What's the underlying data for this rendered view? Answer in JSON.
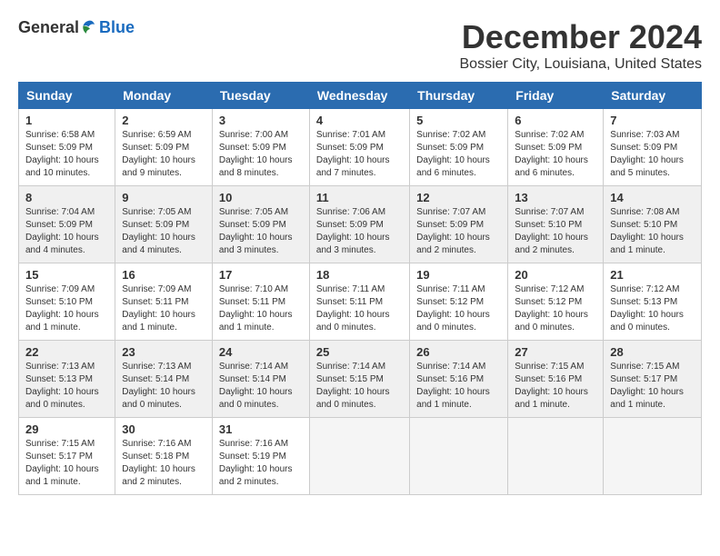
{
  "logo": {
    "general": "General",
    "blue": "Blue"
  },
  "title": {
    "month": "December 2024",
    "location": "Bossier City, Louisiana, United States"
  },
  "headers": [
    "Sunday",
    "Monday",
    "Tuesday",
    "Wednesday",
    "Thursday",
    "Friday",
    "Saturday"
  ],
  "weeks": [
    [
      {
        "day": "1",
        "sunrise": "Sunrise: 6:58 AM",
        "sunset": "Sunset: 5:09 PM",
        "daylight": "Daylight: 10 hours and 10 minutes."
      },
      {
        "day": "2",
        "sunrise": "Sunrise: 6:59 AM",
        "sunset": "Sunset: 5:09 PM",
        "daylight": "Daylight: 10 hours and 9 minutes."
      },
      {
        "day": "3",
        "sunrise": "Sunrise: 7:00 AM",
        "sunset": "Sunset: 5:09 PM",
        "daylight": "Daylight: 10 hours and 8 minutes."
      },
      {
        "day": "4",
        "sunrise": "Sunrise: 7:01 AM",
        "sunset": "Sunset: 5:09 PM",
        "daylight": "Daylight: 10 hours and 7 minutes."
      },
      {
        "day": "5",
        "sunrise": "Sunrise: 7:02 AM",
        "sunset": "Sunset: 5:09 PM",
        "daylight": "Daylight: 10 hours and 6 minutes."
      },
      {
        "day": "6",
        "sunrise": "Sunrise: 7:02 AM",
        "sunset": "Sunset: 5:09 PM",
        "daylight": "Daylight: 10 hours and 6 minutes."
      },
      {
        "day": "7",
        "sunrise": "Sunrise: 7:03 AM",
        "sunset": "Sunset: 5:09 PM",
        "daylight": "Daylight: 10 hours and 5 minutes."
      }
    ],
    [
      {
        "day": "8",
        "sunrise": "Sunrise: 7:04 AM",
        "sunset": "Sunset: 5:09 PM",
        "daylight": "Daylight: 10 hours and 4 minutes."
      },
      {
        "day": "9",
        "sunrise": "Sunrise: 7:05 AM",
        "sunset": "Sunset: 5:09 PM",
        "daylight": "Daylight: 10 hours and 4 minutes."
      },
      {
        "day": "10",
        "sunrise": "Sunrise: 7:05 AM",
        "sunset": "Sunset: 5:09 PM",
        "daylight": "Daylight: 10 hours and 3 minutes."
      },
      {
        "day": "11",
        "sunrise": "Sunrise: 7:06 AM",
        "sunset": "Sunset: 5:09 PM",
        "daylight": "Daylight: 10 hours and 3 minutes."
      },
      {
        "day": "12",
        "sunrise": "Sunrise: 7:07 AM",
        "sunset": "Sunset: 5:09 PM",
        "daylight": "Daylight: 10 hours and 2 minutes."
      },
      {
        "day": "13",
        "sunrise": "Sunrise: 7:07 AM",
        "sunset": "Sunset: 5:10 PM",
        "daylight": "Daylight: 10 hours and 2 minutes."
      },
      {
        "day": "14",
        "sunrise": "Sunrise: 7:08 AM",
        "sunset": "Sunset: 5:10 PM",
        "daylight": "Daylight: 10 hours and 1 minute."
      }
    ],
    [
      {
        "day": "15",
        "sunrise": "Sunrise: 7:09 AM",
        "sunset": "Sunset: 5:10 PM",
        "daylight": "Daylight: 10 hours and 1 minute."
      },
      {
        "day": "16",
        "sunrise": "Sunrise: 7:09 AM",
        "sunset": "Sunset: 5:11 PM",
        "daylight": "Daylight: 10 hours and 1 minute."
      },
      {
        "day": "17",
        "sunrise": "Sunrise: 7:10 AM",
        "sunset": "Sunset: 5:11 PM",
        "daylight": "Daylight: 10 hours and 1 minute."
      },
      {
        "day": "18",
        "sunrise": "Sunrise: 7:11 AM",
        "sunset": "Sunset: 5:11 PM",
        "daylight": "Daylight: 10 hours and 0 minutes."
      },
      {
        "day": "19",
        "sunrise": "Sunrise: 7:11 AM",
        "sunset": "Sunset: 5:12 PM",
        "daylight": "Daylight: 10 hours and 0 minutes."
      },
      {
        "day": "20",
        "sunrise": "Sunrise: 7:12 AM",
        "sunset": "Sunset: 5:12 PM",
        "daylight": "Daylight: 10 hours and 0 minutes."
      },
      {
        "day": "21",
        "sunrise": "Sunrise: 7:12 AM",
        "sunset": "Sunset: 5:13 PM",
        "daylight": "Daylight: 10 hours and 0 minutes."
      }
    ],
    [
      {
        "day": "22",
        "sunrise": "Sunrise: 7:13 AM",
        "sunset": "Sunset: 5:13 PM",
        "daylight": "Daylight: 10 hours and 0 minutes."
      },
      {
        "day": "23",
        "sunrise": "Sunrise: 7:13 AM",
        "sunset": "Sunset: 5:14 PM",
        "daylight": "Daylight: 10 hours and 0 minutes."
      },
      {
        "day": "24",
        "sunrise": "Sunrise: 7:14 AM",
        "sunset": "Sunset: 5:14 PM",
        "daylight": "Daylight: 10 hours and 0 minutes."
      },
      {
        "day": "25",
        "sunrise": "Sunrise: 7:14 AM",
        "sunset": "Sunset: 5:15 PM",
        "daylight": "Daylight: 10 hours and 0 minutes."
      },
      {
        "day": "26",
        "sunrise": "Sunrise: 7:14 AM",
        "sunset": "Sunset: 5:16 PM",
        "daylight": "Daylight: 10 hours and 1 minute."
      },
      {
        "day": "27",
        "sunrise": "Sunrise: 7:15 AM",
        "sunset": "Sunset: 5:16 PM",
        "daylight": "Daylight: 10 hours and 1 minute."
      },
      {
        "day": "28",
        "sunrise": "Sunrise: 7:15 AM",
        "sunset": "Sunset: 5:17 PM",
        "daylight": "Daylight: 10 hours and 1 minute."
      }
    ],
    [
      {
        "day": "29",
        "sunrise": "Sunrise: 7:15 AM",
        "sunset": "Sunset: 5:17 PM",
        "daylight": "Daylight: 10 hours and 1 minute."
      },
      {
        "day": "30",
        "sunrise": "Sunrise: 7:16 AM",
        "sunset": "Sunset: 5:18 PM",
        "daylight": "Daylight: 10 hours and 2 minutes."
      },
      {
        "day": "31",
        "sunrise": "Sunrise: 7:16 AM",
        "sunset": "Sunset: 5:19 PM",
        "daylight": "Daylight: 10 hours and 2 minutes."
      },
      null,
      null,
      null,
      null
    ]
  ]
}
